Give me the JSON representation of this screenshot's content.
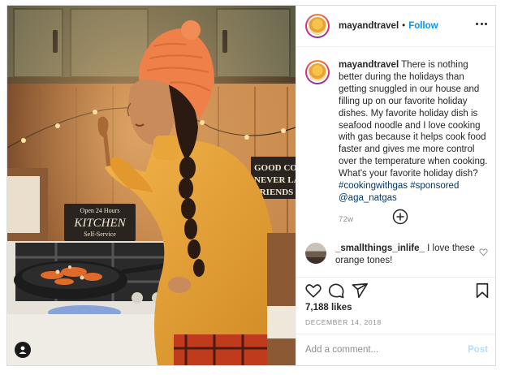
{
  "header": {
    "username": "mayandtravel",
    "separator": "•",
    "follow_label": "Follow"
  },
  "caption": {
    "username": "mayandtravel",
    "text": "There is nothing better during the holidays than getting snuggled in our house and filling up on our favorite holiday dishes. My favorite holiday dish is seafood noodle and I love cooking with gas because it helps cook food faster and gives me more control over the temperature when cooking. What's your favorite holiday dish?",
    "hashtag1": "#cookingwithgas",
    "hashtag2": "#sponsored",
    "mention": "@aga_natgas",
    "time": "72w"
  },
  "comment": {
    "username": "_smallthings_inlife_",
    "text": "I love these orange tones!"
  },
  "likes": "7,188 likes",
  "date": "DECEMBER 14, 2018",
  "comment_input": {
    "placeholder": "Add a comment...",
    "post_label": "Post"
  },
  "photo_signs": {
    "kitchen_line1": "Open 24 Hours",
    "kitchen_line2": "KITCHEN",
    "kitchen_line3": "Self-Service",
    "good_line1": "GOOD COOK",
    "good_line2": "NEVER LAC",
    "good_line3": "FRIENDS"
  },
  "colors": {
    "follow_blue": "#0095f6",
    "link_navy": "#00376b",
    "post_disabled": "#b2dffc",
    "hat_orange": "#f0804a",
    "sweater_yellow": "#e8a63a"
  },
  "icons": [
    "more-options-icon",
    "user-tag-icon",
    "load-more-icon",
    "heart-icon",
    "comment-icon",
    "share-icon",
    "bookmark-icon"
  ]
}
